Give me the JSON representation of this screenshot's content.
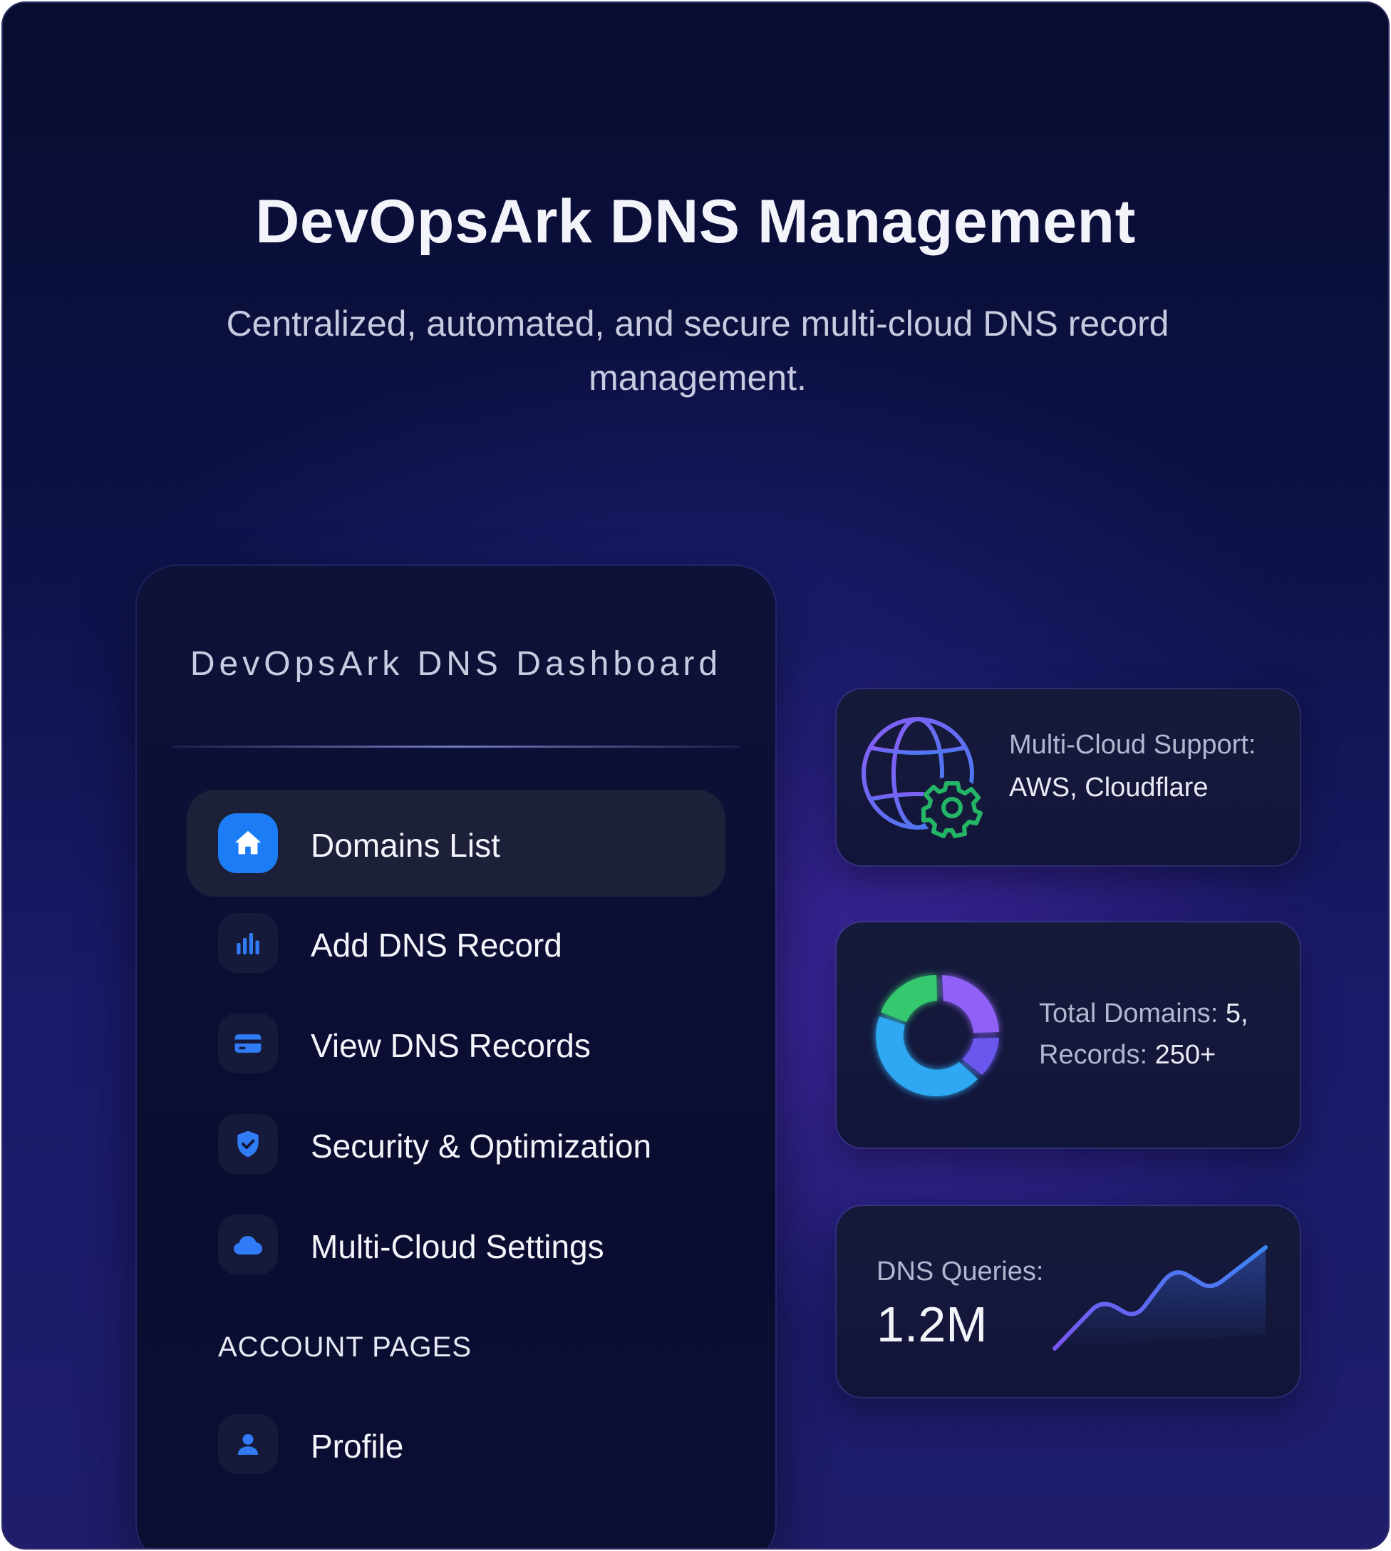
{
  "hero": {
    "title": "DevOpsArk DNS Management",
    "subtitle": "Centralized, automated, and secure multi-cloud DNS record management."
  },
  "sidebar": {
    "title": "DevOpsArk DNS Dashboard",
    "items": [
      {
        "label": "Domains List",
        "icon": "home-icon",
        "active": true
      },
      {
        "label": "Add DNS Record",
        "icon": "bar-chart-icon",
        "active": false
      },
      {
        "label": "View DNS Records",
        "icon": "credit-card-icon",
        "active": false
      },
      {
        "label": "Security & Optimization",
        "icon": "shield-check-icon",
        "active": false
      },
      {
        "label": "Multi-Cloud Settings",
        "icon": "cloud-icon",
        "active": false
      }
    ],
    "section_label": "ACCOUNT PAGES",
    "account_items": [
      {
        "label": "Profile",
        "icon": "user-icon"
      }
    ]
  },
  "cards": {
    "cloud": {
      "label": "Multi-Cloud Support:",
      "value": "AWS, Cloudflare",
      "icon": "globe-gear-icon"
    },
    "domains": {
      "label1": "Total Domains:",
      "value1": "5,",
      "label2": "Records:",
      "value2": "250+",
      "icon": "donut-chart-icon"
    },
    "queries": {
      "label": "DNS Queries:",
      "value": "1.2M",
      "icon": "sparkline-icon"
    }
  },
  "colors": {
    "accent": "#1c7cf5",
    "background_top": "#080c2e",
    "background_bottom": "#1f1d6c",
    "panel": "#0e1238",
    "icon_blue": "#2f7cf6",
    "donut_green": "#35c86e",
    "donut_purple": "#8f5cf6",
    "donut_cyan": "#30a8f0",
    "gear_green": "#25b566"
  }
}
